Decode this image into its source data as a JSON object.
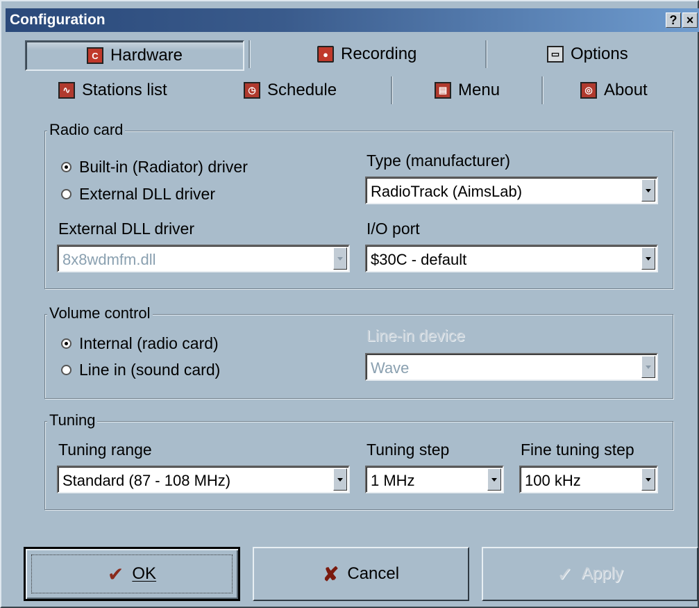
{
  "window": {
    "title": "Configuration",
    "help_button": "?",
    "close_button": "×"
  },
  "tabs_row1": [
    {
      "label": "Hardware",
      "icon": "hardware-icon",
      "active": true
    },
    {
      "label": "Recording",
      "icon": "record-icon",
      "active": false
    },
    {
      "label": "Options",
      "icon": "options-icon",
      "active": false
    }
  ],
  "tabs_row2": [
    {
      "label": "Stations list",
      "icon": "stations-icon"
    },
    {
      "label": "Schedule",
      "icon": "clock-icon"
    },
    {
      "label": "Menu",
      "icon": "menu-icon"
    },
    {
      "label": "About",
      "icon": "about-icon"
    }
  ],
  "radio_card": {
    "legend": "Radio card",
    "option_builtin": "Built-in (Radiator) driver",
    "option_external": "External DLL driver",
    "selected": "builtin",
    "type_label": "Type (manufacturer)",
    "type_value": "RadioTrack (AimsLab)",
    "dll_label": "External DLL driver",
    "dll_value": "8x8wdmfm.dll",
    "port_label": "I/O port",
    "port_value": "$30C - default"
  },
  "volume": {
    "legend": "Volume control",
    "option_internal": "Internal (radio card)",
    "option_linein": "Line in (sound card)",
    "selected": "internal",
    "device_label": "Line-in device",
    "device_value": "Wave"
  },
  "tuning": {
    "legend": "Tuning",
    "range_label": "Tuning range",
    "range_value": "Standard (87 - 108 MHz)",
    "step_label": "Tuning step",
    "step_value": "1 MHz",
    "fine_label": "Fine tuning step",
    "fine_value": "100 kHz"
  },
  "buttons": {
    "ok": "OK",
    "cancel": "Cancel",
    "apply": "Apply"
  },
  "colors": {
    "face": "#a9bccb",
    "title_start": "#2a497a",
    "title_end": "#6f9ccf"
  }
}
